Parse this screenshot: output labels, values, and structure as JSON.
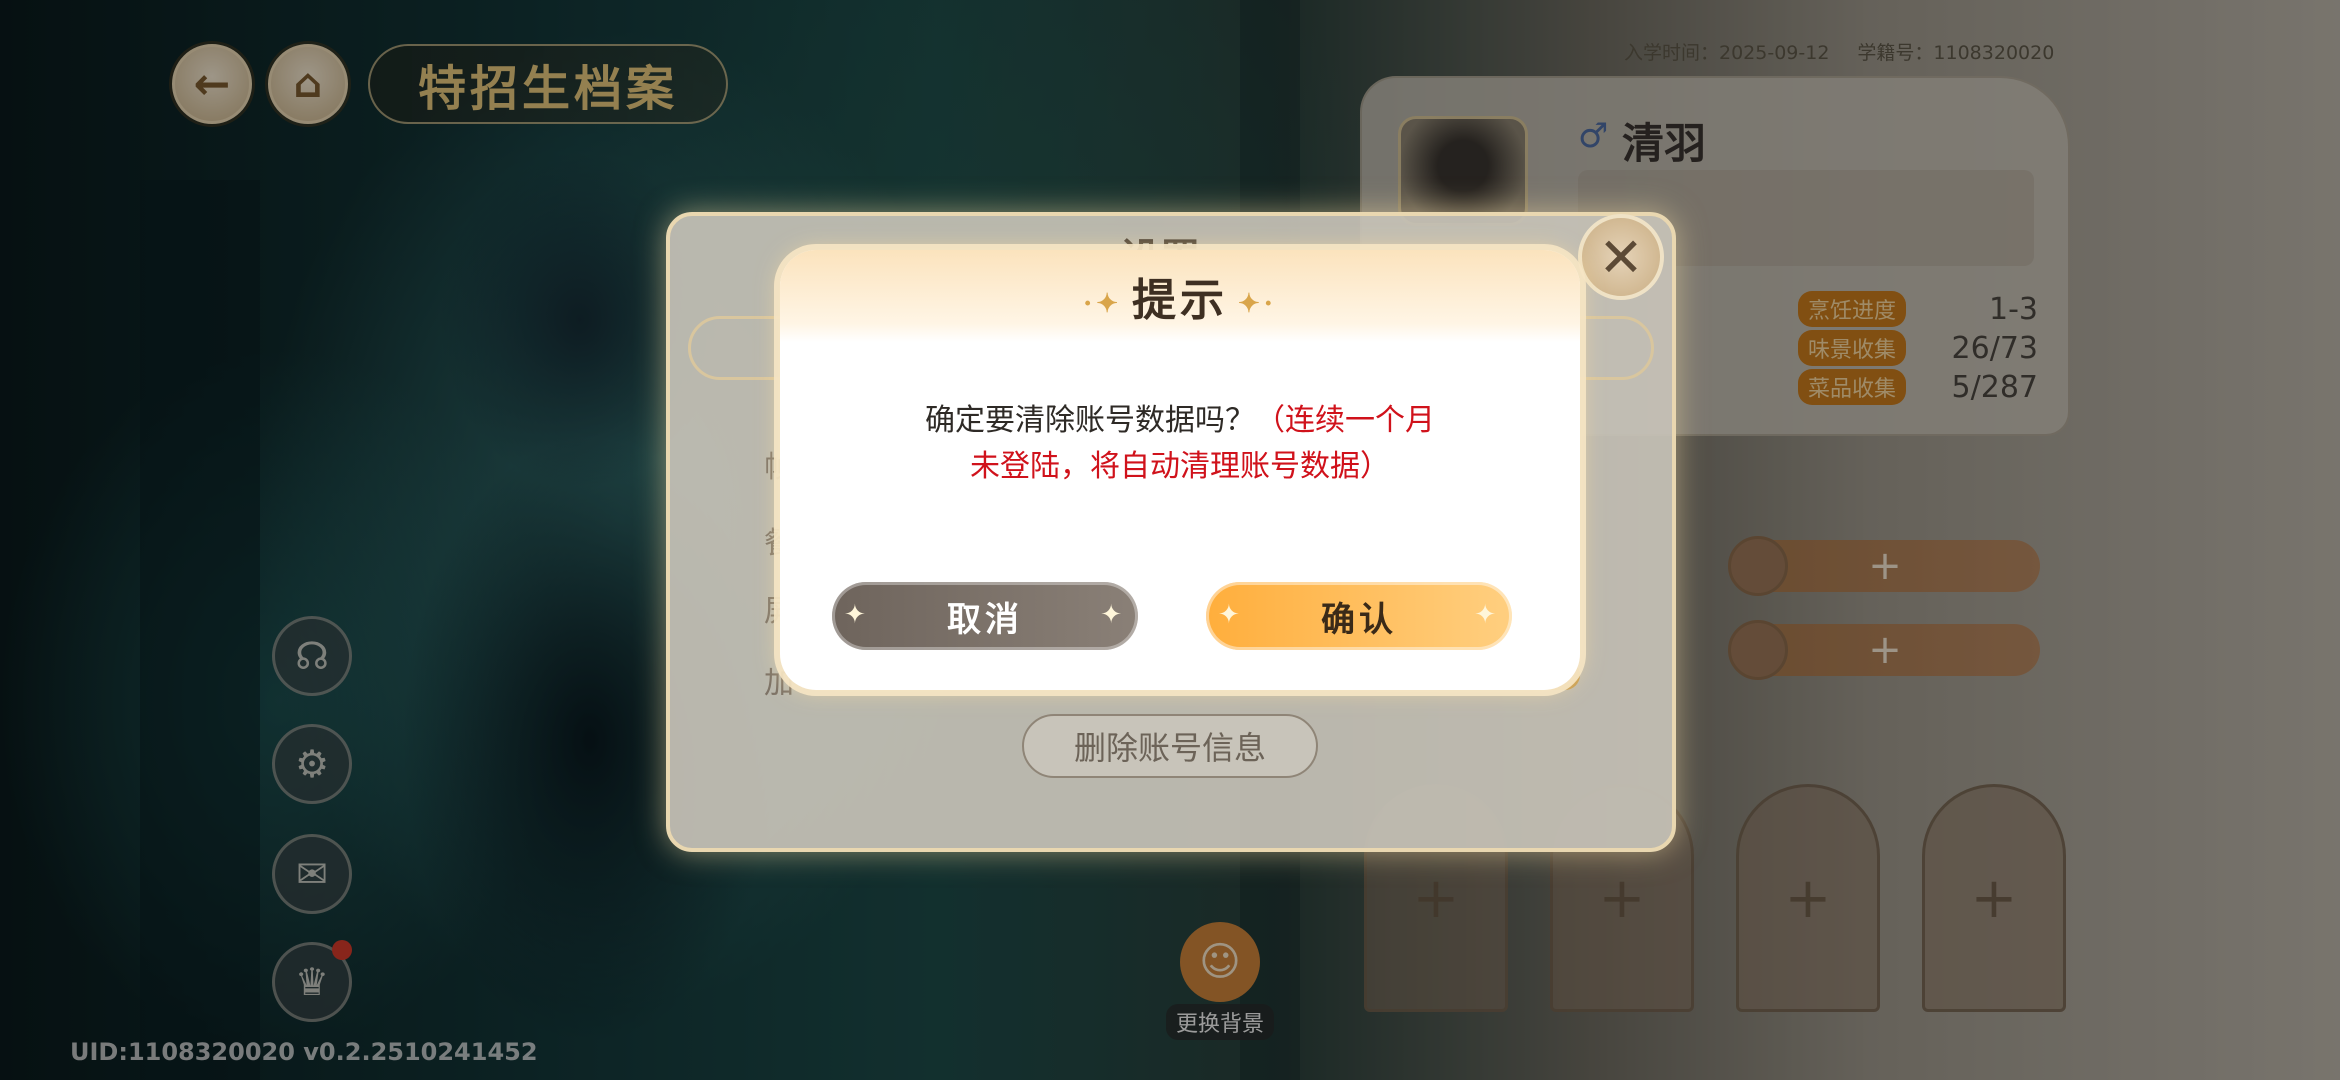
{
  "header": {
    "title": "特招生档案",
    "back_icon": "back-arrow-icon",
    "home_icon": "home-icon"
  },
  "profile": {
    "enroll_time": "入学时间：2025-09-12",
    "student_id": "学籍号：1108320020",
    "name": "清羽",
    "gender_icon": "♂",
    "stats": [
      {
        "label": "烹饪进度",
        "value": "1-3"
      },
      {
        "label": "味景收集",
        "value": "26/73"
      },
      {
        "label": "菜品收集",
        "value": "5/287"
      }
    ],
    "slot_plus": "+",
    "arch_plus": "+"
  },
  "side_menu": [
    "headset-icon",
    "gear-icon",
    "mailbox-icon",
    "trophy-icon"
  ],
  "change_bg_label": "更换背景",
  "uid_text": "UID:1108320020  v0.2.2510241452",
  "settings": {
    "title": "设置",
    "rows_visible": [
      "帧",
      "餐",
      "屏",
      "加"
    ],
    "delete_account_label": "删除账号信息",
    "close_icon": "✕"
  },
  "dialog": {
    "title": "提示",
    "message_main": "确定要清除账号数据吗？",
    "message_warn_1": "（连续一个月",
    "message_warn_2": "未登陆，将自动清理账号数据）",
    "cancel_label": "取消",
    "confirm_label": "确认"
  },
  "colors": {
    "warning_red": "#d0121b",
    "confirm_orange": "#ffae3c",
    "cancel_gray": "#6e645c",
    "stat_tag": "#c77a1c"
  }
}
